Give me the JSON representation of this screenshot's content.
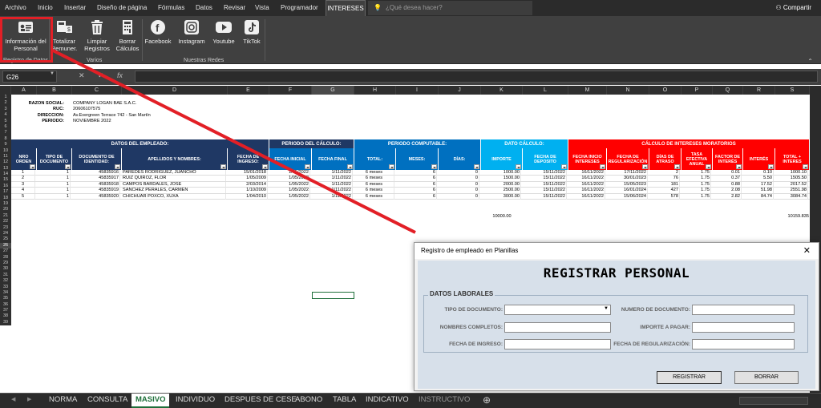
{
  "menu": {
    "tabs": [
      "Archivo",
      "Inicio",
      "Insertar",
      "Diseño de página",
      "Fórmulas",
      "Datos",
      "Revisar",
      "Vista",
      "Programador",
      "INTERESES"
    ],
    "active": "INTERESES",
    "tell_me": "¿Qué desea hacer?",
    "share": "Compartir"
  },
  "ribbon": {
    "buttons": [
      {
        "label": "Información del Personal",
        "icon": "contact-card-icon"
      },
      {
        "label": "Totalizar Remuner.",
        "icon": "money-calculator-icon"
      },
      {
        "label": "Limpiar Registros",
        "icon": "trash-icon"
      },
      {
        "label": "Borrar Cálculos",
        "icon": "calculator-erase-icon"
      },
      {
        "label": "Facebook",
        "icon": "facebook-icon"
      },
      {
        "label": "Instagram",
        "icon": "instagram-icon"
      },
      {
        "label": "Youtube",
        "icon": "youtube-icon"
      },
      {
        "label": "TikTok",
        "icon": "tiktok-icon"
      }
    ],
    "groups": [
      "Registro de Datos",
      "Varios",
      "Nuestras Redes"
    ]
  },
  "formula_bar": {
    "name_box": "G26",
    "cancel": "✕",
    "enter": "✓",
    "fx": "fx",
    "value": ""
  },
  "columns": [
    "A",
    "B",
    "C",
    "D",
    "E",
    "F",
    "G",
    "H",
    "I",
    "J",
    "K",
    "L",
    "M",
    "N",
    "O",
    "P",
    "Q",
    "R",
    "S"
  ],
  "rows": [
    "1",
    "2",
    "3",
    "4",
    "5",
    "6",
    "7",
    "8",
    "9",
    "10",
    "11",
    "12",
    "13",
    "14",
    "15",
    "16",
    "17",
    "18",
    "19",
    "20",
    "21",
    "22",
    "23",
    "24",
    "25",
    "26",
    "27",
    "28",
    "29",
    "30",
    "31",
    "32",
    "33",
    "34",
    "35",
    "36",
    "37",
    "38",
    "39"
  ],
  "company": {
    "labels": [
      "RAZON SOCIAL:",
      "RUC:",
      "DIRECCIÓN:",
      "PERIODO:"
    ],
    "values": [
      "COMPANY LOGAN BAE S.A.C.",
      "20606107575",
      "Av.Evergreen Terrace 742 - San Martín",
      "NOVIEMBRE 2022"
    ]
  },
  "groups": [
    "DATOS DEL EMPLEADO:",
    "PERIODO DEL CÁLCULO:",
    "PERIODO COMPUTABLE:",
    "DATO CÁLCULO:",
    "CÁLCULO DE INTERESES MORATORIOS"
  ],
  "headers": [
    "NRO ORDEN",
    "TIPO DE DOCUMENTO",
    "DOCUMENTO DE IDENTIDAD:",
    "APELLIDOS Y NOMBRES:",
    "FECHA DE INGRESO:",
    "FECHA INICIAL",
    "FECHA FINAL",
    "TOTAL:",
    "MESES:",
    "DÍAS:",
    "IMPORTE",
    "FECHA DE DEPOSITO",
    "FECHA INICIO INTERESES",
    "FECHA DE REGULARIZACIÓN",
    "DÍAS DE ATRASO",
    "TASA EFECTIVA ANUAL",
    "FACTOR DE INTERÉS",
    "INTERÉS",
    "TOTAL + INTERES"
  ],
  "table": [
    [
      "1",
      "1",
      "45835916",
      "PAREDES RODRIGUEZ, JUANCHO",
      "15/01/2018",
      "1/05/2022",
      "1/11/2022",
      "6 meses",
      "6",
      "0",
      "1000.00",
      "15/11/2022",
      "16/11/2022",
      "17/11/2022",
      "2",
      "1.75",
      "0.01",
      "0.10",
      "1000.10"
    ],
    [
      "2",
      "1",
      "45835917",
      "RUIZ QUIROZ, FLOR",
      "1/05/2009",
      "1/05/2022",
      "1/11/2022",
      "6 meses",
      "6",
      "0",
      "1500.00",
      "15/11/2022",
      "16/11/2022",
      "30/01/2023",
      "76",
      "1.75",
      "0.37",
      "5.50",
      "1505.50"
    ],
    [
      "3",
      "1",
      "45835918",
      "CAMPOS BARDALES, JOSE",
      "2/03/2014",
      "1/05/2022",
      "1/11/2022",
      "6 meses",
      "6",
      "0",
      "2000.00",
      "15/11/2022",
      "16/11/2022",
      "15/05/2023",
      "181",
      "1.75",
      "0.88",
      "17.52",
      "2017.52"
    ],
    [
      "4",
      "1",
      "45835919",
      "SANCHEZ PERALES, CARMEN",
      "1/10/2009",
      "1/05/2022",
      "1/11/2022",
      "6 meses",
      "6",
      "0",
      "2500.00",
      "15/11/2022",
      "16/11/2022",
      "16/01/2024",
      "427",
      "1.75",
      "2.08",
      "51.98",
      "2551.98"
    ],
    [
      "5",
      "1",
      "45835920",
      "CHICHUAR POXCO, XUXA",
      "1/04/2010",
      "1/05/2022",
      "1/11/2022",
      "6 meses",
      "6",
      "0",
      "3000.00",
      "15/11/2022",
      "16/11/2022",
      "15/06/2024",
      "578",
      "1.75",
      "2.82",
      "84.74",
      "3084.74"
    ]
  ],
  "totals": {
    "importe": "10000.00",
    "total_interes": "10159.835"
  },
  "sheets": [
    "NORMA",
    "CONSULTA",
    "MASIVO",
    "INDIVIDUO",
    "DESPUES DE CESE",
    "ABONO",
    "TABLA",
    "INDICATIVO",
    "INSTRUCTIVO"
  ],
  "active_sheet": "MASIVO",
  "dialog": {
    "title": "Registro de empleado en Planillas",
    "close": "✕",
    "heading": "REGISTRAR PERSONAL",
    "section": "DATOS LABORALES",
    "fields": [
      "TIPO DE DOCUMENTO:",
      "NUMERO DE DOCUMENTO:",
      "NOMBRES COMPLETOS:",
      "IMPORTE A PAGAR:",
      "FECHA DE INGRESO:",
      "FECHA DE REGULARIZACIÓN:"
    ],
    "register_button": "REGISTRAR",
    "clear_button": "BORRAR"
  },
  "colors": {
    "navy": "#1f3864",
    "blue": "#0070c0",
    "cyan": "#00b0f0",
    "red": "#ff0000",
    "annotation": "#e21f26",
    "excel_green": "#1e6f3a"
  }
}
